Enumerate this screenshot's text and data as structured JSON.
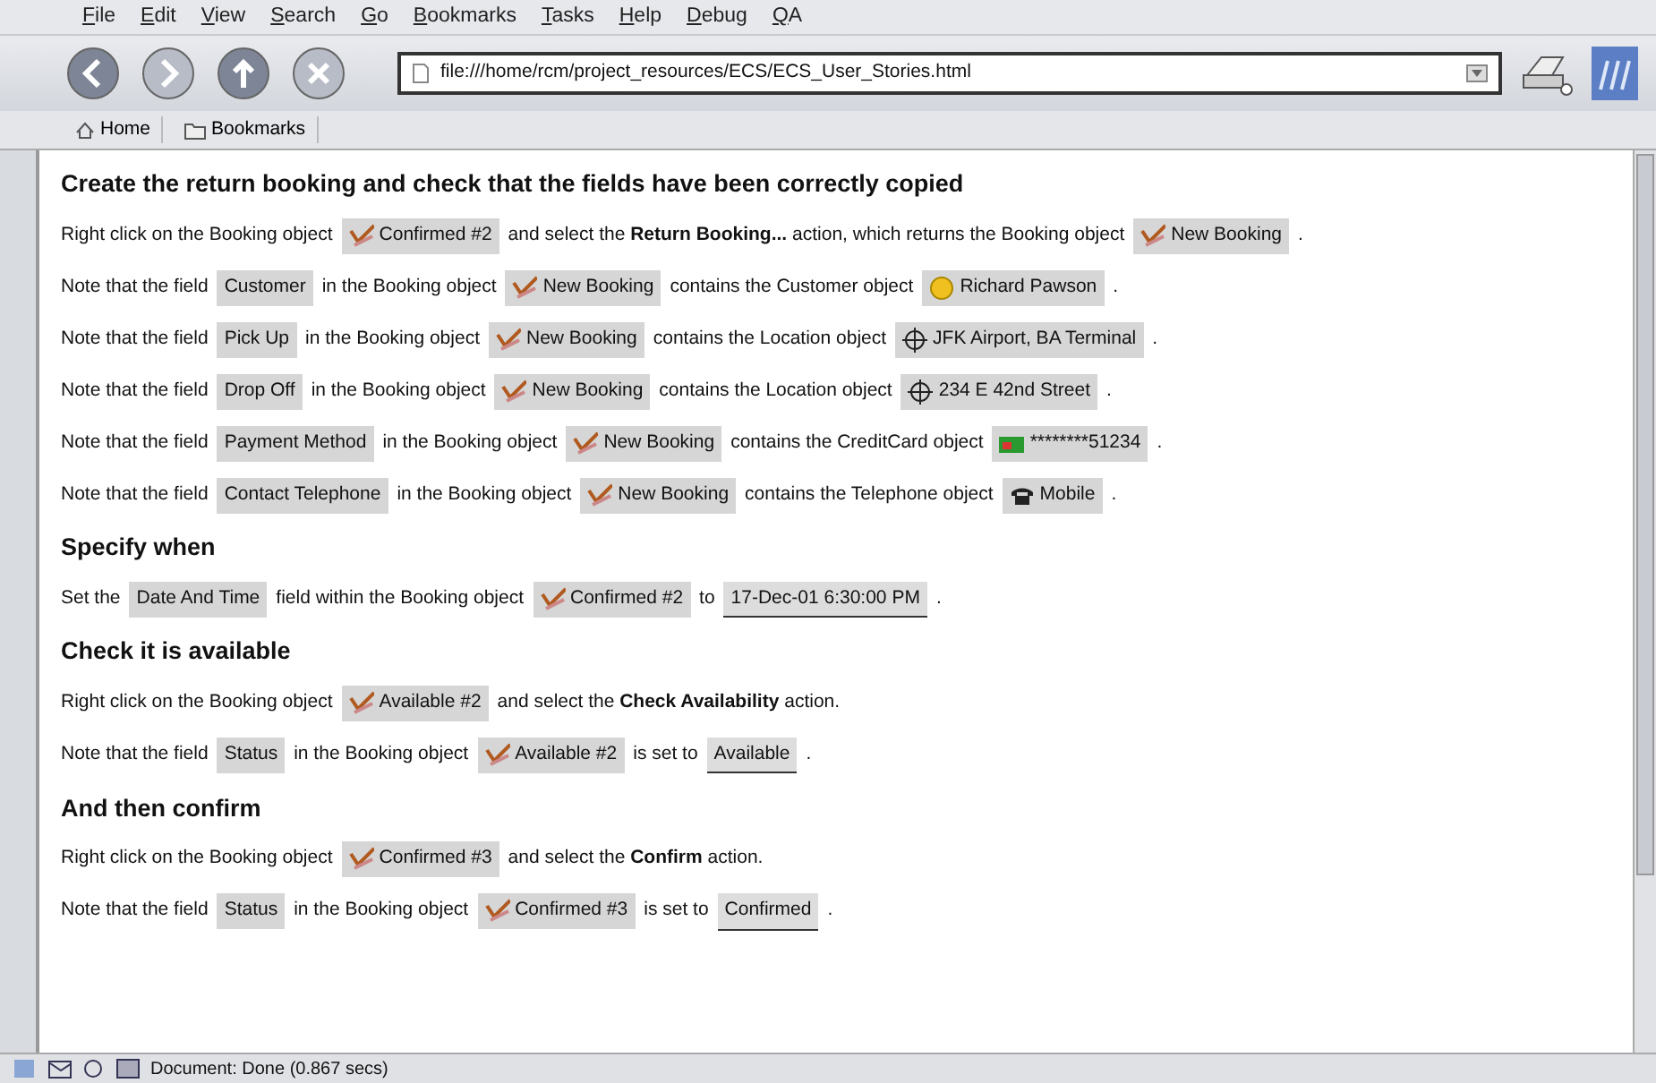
{
  "menu": [
    "File",
    "Edit",
    "View",
    "Search",
    "Go",
    "Bookmarks",
    "Tasks",
    "Help",
    "Debug",
    "QA"
  ],
  "toolbar": {
    "url": "file:///home/rcm/project_resources/ECS/ECS_User_Stories.html",
    "buttons": [
      {
        "kind": "back",
        "disabled": false
      },
      {
        "kind": "forward",
        "disabled": true
      },
      {
        "kind": "reload",
        "disabled": false
      },
      {
        "kind": "stop",
        "disabled": true
      }
    ]
  },
  "personal_bar": [
    {
      "kind": "home",
      "label": "Home"
    },
    {
      "kind": "folder",
      "label": "Bookmarks"
    }
  ],
  "content": [
    {
      "kind": "heading",
      "text": "Create the return booking and check that the fields have been correctly copied"
    },
    {
      "kind": "step",
      "segments": [
        {
          "kind": "text",
          "text": "Right click on the Booking object"
        },
        {
          "kind": "booking",
          "text": "Confirmed #2"
        },
        {
          "kind": "text",
          "text": "and select the **Return Booking...** action, which returns the Booking object"
        },
        {
          "kind": "booking",
          "text": "New Booking"
        },
        {
          "kind": "text",
          "text": "."
        }
      ]
    },
    {
      "kind": "step",
      "segments": [
        {
          "kind": "text",
          "text": "Note that the field"
        },
        {
          "kind": "field",
          "text": "Customer"
        },
        {
          "kind": "text",
          "text": "in the Booking object"
        },
        {
          "kind": "booking",
          "text": "New Booking"
        },
        {
          "kind": "text",
          "text": "contains the Customer object"
        },
        {
          "kind": "customer",
          "text": "Richard Pawson"
        },
        {
          "kind": "text",
          "text": "."
        }
      ]
    },
    {
      "kind": "step",
      "segments": [
        {
          "kind": "text",
          "text": "Note that the field"
        },
        {
          "kind": "field",
          "text": "Pick Up"
        },
        {
          "kind": "text",
          "text": "in the Booking object"
        },
        {
          "kind": "booking",
          "text": "New Booking"
        },
        {
          "kind": "text",
          "text": "contains the Location object"
        },
        {
          "kind": "location",
          "text": "JFK Airport, BA Terminal"
        },
        {
          "kind": "text",
          "text": "."
        }
      ]
    },
    {
      "kind": "step",
      "segments": [
        {
          "kind": "text",
          "text": "Note that the field"
        },
        {
          "kind": "field",
          "text": "Drop Off"
        },
        {
          "kind": "text",
          "text": "in the Booking object"
        },
        {
          "kind": "booking",
          "text": "New Booking"
        },
        {
          "kind": "text",
          "text": "contains the Location object"
        },
        {
          "kind": "location",
          "text": "234 E 42nd Street"
        },
        {
          "kind": "text",
          "text": "."
        }
      ]
    },
    {
      "kind": "step",
      "segments": [
        {
          "kind": "text",
          "text": "Note that the field"
        },
        {
          "kind": "field",
          "text": "Payment Method"
        },
        {
          "kind": "text",
          "text": "in the Booking object"
        },
        {
          "kind": "booking",
          "text": "New Booking"
        },
        {
          "kind": "text",
          "text": "contains the CreditCard object"
        },
        {
          "kind": "creditcard",
          "text": "********51234"
        },
        {
          "kind": "text",
          "text": "."
        }
      ]
    },
    {
      "kind": "step",
      "segments": [
        {
          "kind": "text",
          "text": "Note that the field"
        },
        {
          "kind": "field",
          "text": "Contact Telephone"
        },
        {
          "kind": "text",
          "text": "in the Booking object"
        },
        {
          "kind": "booking",
          "text": "New Booking"
        },
        {
          "kind": "text",
          "text": "contains the Telephone object"
        },
        {
          "kind": "telephone",
          "text": "Mobile"
        },
        {
          "kind": "text",
          "text": "."
        }
      ]
    },
    {
      "kind": "heading",
      "text": "Specify when"
    },
    {
      "kind": "step",
      "segments": [
        {
          "kind": "text",
          "text": "Set the"
        },
        {
          "kind": "field",
          "text": "Date And Time"
        },
        {
          "kind": "text",
          "text": "field within the Booking object"
        },
        {
          "kind": "booking",
          "text": "Confirmed #2"
        },
        {
          "kind": "text",
          "text": "to"
        },
        {
          "kind": "value",
          "text": "17-Dec-01 6:30:00 PM"
        },
        {
          "kind": "text",
          "text": "."
        }
      ]
    },
    {
      "kind": "heading",
      "text": "Check it is available"
    },
    {
      "kind": "step",
      "segments": [
        {
          "kind": "text",
          "text": "Right click on the Booking object"
        },
        {
          "kind": "booking",
          "text": "Available #2"
        },
        {
          "kind": "text",
          "text": "and select the **Check Availability** action."
        }
      ]
    },
    {
      "kind": "step",
      "segments": [
        {
          "kind": "text",
          "text": "Note that the field"
        },
        {
          "kind": "field",
          "text": "Status"
        },
        {
          "kind": "text",
          "text": "in the Booking object"
        },
        {
          "kind": "booking",
          "text": "Available #2"
        },
        {
          "kind": "text",
          "text": "is set to"
        },
        {
          "kind": "value",
          "text": "Available"
        },
        {
          "kind": "text",
          "text": "."
        }
      ]
    },
    {
      "kind": "heading",
      "text": "And then confirm"
    },
    {
      "kind": "step",
      "segments": [
        {
          "kind": "text",
          "text": "Right click on the Booking object"
        },
        {
          "kind": "booking",
          "text": "Confirmed #3"
        },
        {
          "kind": "text",
          "text": "and select the **Confirm** action."
        }
      ]
    },
    {
      "kind": "step",
      "segments": [
        {
          "kind": "text",
          "text": "Note that the field"
        },
        {
          "kind": "field",
          "text": "Status"
        },
        {
          "kind": "text",
          "text": "in the Booking object"
        },
        {
          "kind": "booking",
          "text": "Confirmed #3"
        },
        {
          "kind": "text",
          "text": "is set to"
        },
        {
          "kind": "value",
          "text": "Confirmed"
        },
        {
          "kind": "text",
          "text": "."
        }
      ]
    }
  ],
  "status_bar": {
    "text": "Document: Done (0.867 secs)"
  }
}
